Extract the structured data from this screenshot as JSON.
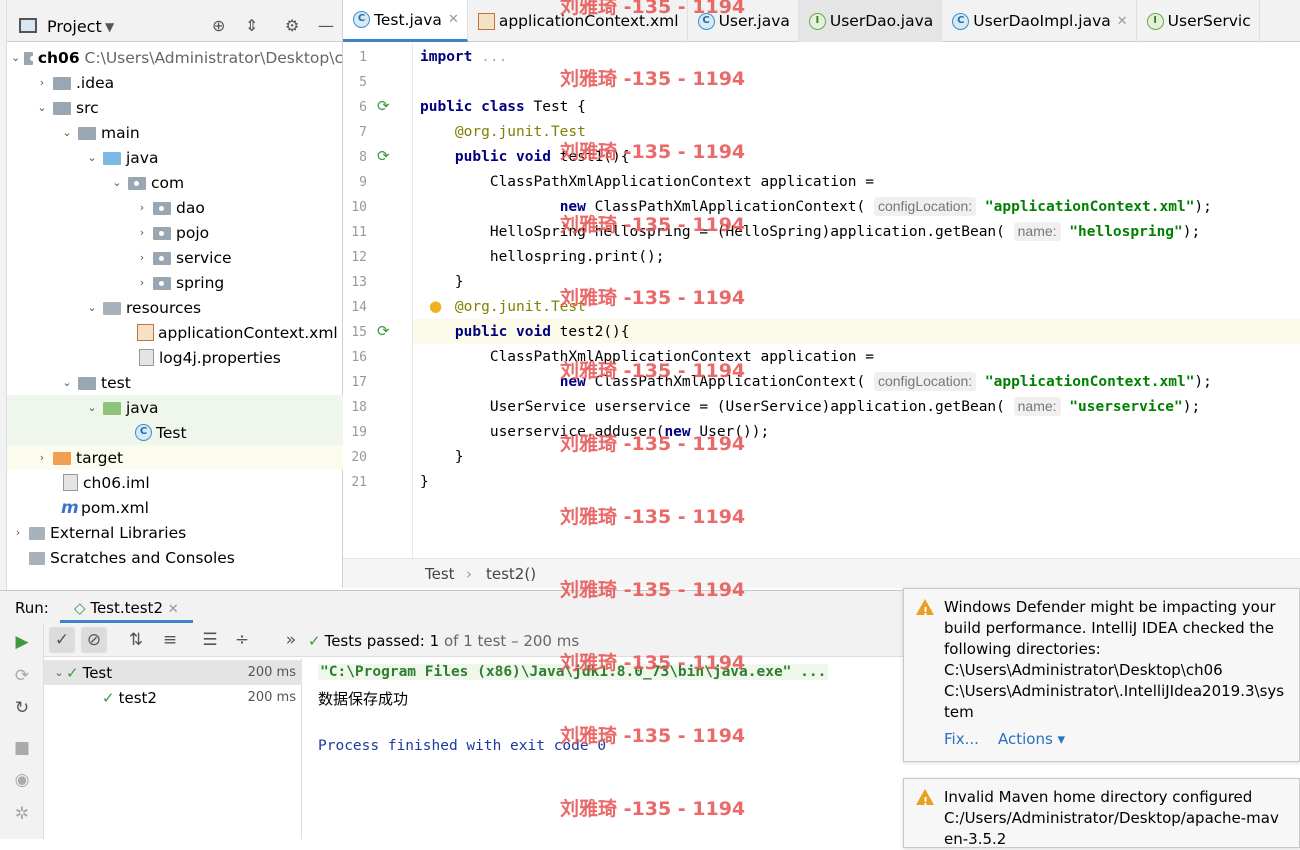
{
  "project_panel": {
    "title": "Project",
    "tree": [
      {
        "label": "ch06",
        "path": "C:\\Users\\Administrator\\Desktop\\c"
      },
      {
        "label": ".idea"
      },
      {
        "label": "src"
      },
      {
        "label": "main"
      },
      {
        "label": "java"
      },
      {
        "label": "com"
      },
      {
        "label": "dao"
      },
      {
        "label": "pojo"
      },
      {
        "label": "service"
      },
      {
        "label": "spring"
      },
      {
        "label": "resources"
      },
      {
        "label": "applicationContext.xml"
      },
      {
        "label": "log4j.properties"
      },
      {
        "label": "test"
      },
      {
        "label": "java"
      },
      {
        "label": "Test"
      },
      {
        "label": "target"
      },
      {
        "label": "ch06.iml"
      },
      {
        "label": "pom.xml"
      },
      {
        "label": "External Libraries"
      },
      {
        "label": "Scratches and Consoles"
      }
    ]
  },
  "tabs": [
    "Test.java",
    "applicationContext.xml",
    "User.java",
    "UserDao.java",
    "UserDaoImpl.java",
    "UserServic"
  ],
  "editor": {
    "line_numbers": [
      "1",
      "5",
      "6",
      "7",
      "8",
      "9",
      "10",
      "11",
      "12",
      "13",
      "14",
      "15",
      "16",
      "17",
      "18",
      "19",
      "20",
      "21"
    ],
    "hints": {
      "config": "configLocation:",
      "name": "name:"
    },
    "strings": {
      "ctx": "\"applicationContext.xml\"",
      "hellospring": "\"hellospring\"",
      "userservice": "\"userservice\""
    },
    "breadcrumb": [
      "Test",
      "test2()"
    ]
  },
  "run": {
    "label": "Run:",
    "config_tab": "Test.test2",
    "status": "Tests passed:",
    "count": "1",
    "detail": "of 1 test – 200 ms",
    "tests": [
      {
        "name": "Test",
        "time": "200 ms"
      },
      {
        "name": "test2",
        "time": "200 ms"
      }
    ],
    "output": [
      "\"C:\\Program Files (x86)\\Java\\jdk1.8.0_73\\bin\\java.exe\" ...",
      "数据保存成功",
      "Process finished with exit code 0"
    ]
  },
  "notifications": [
    {
      "text": "Windows Defender might be impacting your build performance. IntelliJ IDEA checked the following directories:",
      "paths": [
        "C:\\Users\\Administrator\\Desktop\\ch06",
        "C:\\Users\\Administrator\\.IntelliJIdea2019.3\\sys",
        "tem"
      ],
      "actions": [
        "Fix...",
        "Actions ▾"
      ]
    },
    {
      "text": "Invalid Maven home directory configured",
      "paths": [
        "C:/Users/Administrator/Desktop/apache-mav",
        "en-3.5.2"
      ]
    }
  ],
  "watermark": "刘雅琦 -135 - 1194",
  "colors": {
    "keyword": "#000080",
    "annotation": "#808000",
    "string": "#008000",
    "watermark": "#e85a5a",
    "accent": "#4083c9"
  }
}
